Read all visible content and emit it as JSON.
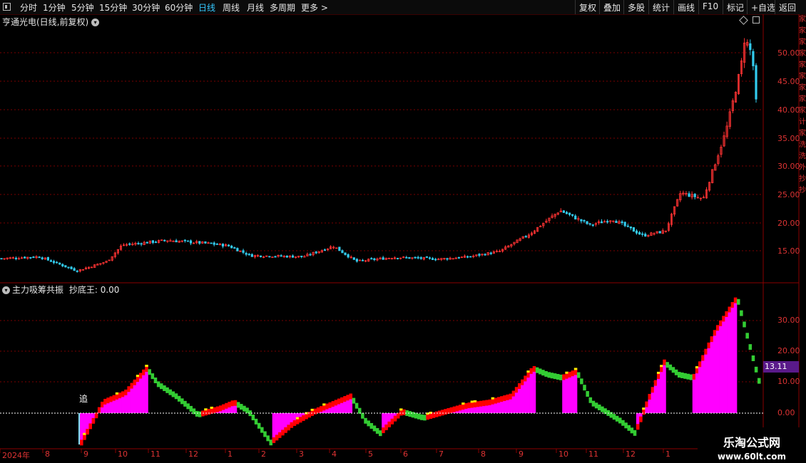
{
  "toolbar": {
    "periods": [
      "分时",
      "1分钟",
      "5分钟",
      "15分钟",
      "30分钟",
      "60分钟",
      "日线",
      "周线",
      "月线",
      "多周期",
      "更多 >"
    ],
    "active": "日线",
    "right_buttons": [
      "复权",
      "叠加",
      "多股",
      "统计",
      "画线",
      "F10",
      "标记",
      "+自选",
      "返回"
    ]
  },
  "main_panel": {
    "title": "亨通光电(日线,前复权)",
    "price_ticks": [
      "50.00",
      "45.00",
      "40.00",
      "35.00",
      "30.00",
      "25.00",
      "20.00",
      "15.00"
    ]
  },
  "indicator_panel": {
    "title": "主力吸筹共振",
    "value_text": "抄底王: 0.00",
    "ticks": [
      "30.00",
      "20.00",
      "10.00",
      "0.00"
    ],
    "current_value": "13.11",
    "marker_text": "追"
  },
  "date_axis": [
    "2024年",
    "8",
    "9",
    "10",
    "11",
    "12",
    "1",
    "2",
    "3",
    "4",
    "5",
    "6",
    "7",
    "8",
    "9",
    "10",
    "11",
    "12",
    "1"
  ],
  "watermark": {
    "line1": "乐淘公式网",
    "line2": "www.60lt.com"
  },
  "right_strip": "家家家家家家家家家计家洗洗外抄抄",
  "colors": {
    "up": "#ff3333",
    "down": "#33ccee",
    "magenta": "#ff00ff",
    "red": "#ff0000",
    "green": "#33cc33",
    "yellow": "#ffee00",
    "grid": "#7a0000"
  },
  "chart_data": {
    "type": "candlestick",
    "ylim": [
      12,
      56
    ],
    "close_curve": [
      [
        0,
        15.3
      ],
      [
        0.05,
        15.6
      ],
      [
        0.1,
        13.2
      ],
      [
        0.14,
        14.8
      ],
      [
        0.16,
        17.6
      ],
      [
        0.22,
        18.4
      ],
      [
        0.27,
        17.9
      ],
      [
        0.3,
        17.5
      ],
      [
        0.33,
        15.8
      ],
      [
        0.4,
        15.6
      ],
      [
        0.44,
        17.4
      ],
      [
        0.47,
        14.8
      ],
      [
        0.52,
        15.5
      ],
      [
        0.58,
        15.2
      ],
      [
        0.62,
        15.6
      ],
      [
        0.66,
        16.5
      ],
      [
        0.7,
        19.5
      ],
      [
        0.74,
        23.5
      ],
      [
        0.78,
        21
      ],
      [
        0.81,
        22
      ],
      [
        0.85,
        19.2
      ],
      [
        0.88,
        20
      ],
      [
        0.9,
        26.5
      ],
      [
        0.93,
        25.5
      ],
      [
        0.96,
        37
      ],
      [
        0.98,
        48
      ],
      [
        0.985,
        53
      ],
      [
        0.995,
        50
      ],
      [
        1.0,
        42
      ]
    ]
  },
  "indicator_data": {
    "ylim": [
      -12,
      40
    ],
    "curve": [
      [
        0,
        null
      ],
      [
        0.07,
        -10
      ],
      [
        0.1,
        3
      ],
      [
        0.13,
        6
      ],
      [
        0.16,
        14
      ],
      [
        0.175,
        9
      ],
      [
        0.2,
        5
      ],
      [
        0.23,
        -1
      ],
      [
        0.26,
        1
      ],
      [
        0.28,
        3
      ],
      [
        0.3,
        0
      ],
      [
        0.33,
        -10
      ],
      [
        0.36,
        -4
      ],
      [
        0.39,
        0
      ],
      [
        0.42,
        3
      ],
      [
        0.44,
        5
      ],
      [
        0.46,
        -3
      ],
      [
        0.48,
        -7
      ],
      [
        0.51,
        0
      ],
      [
        0.54,
        -2
      ],
      [
        0.57,
        0
      ],
      [
        0.6,
        2
      ],
      [
        0.63,
        3
      ],
      [
        0.66,
        5
      ],
      [
        0.69,
        14
      ],
      [
        0.71,
        12
      ],
      [
        0.73,
        11
      ],
      [
        0.75,
        13
      ],
      [
        0.77,
        3
      ],
      [
        0.79,
        0
      ],
      [
        0.81,
        -3
      ],
      [
        0.83,
        -7
      ],
      [
        0.85,
        5
      ],
      [
        0.87,
        16
      ],
      [
        0.89,
        12
      ],
      [
        0.91,
        11
      ],
      [
        0.94,
        26
      ],
      [
        0.97,
        37
      ],
      [
        1.0,
        10
      ]
    ]
  }
}
